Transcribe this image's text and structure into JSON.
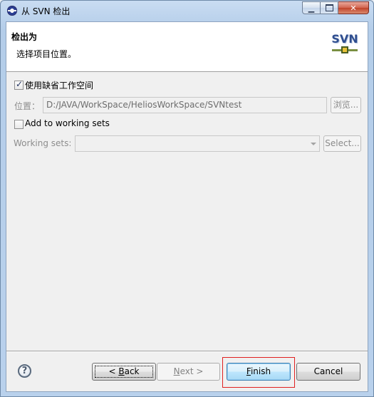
{
  "window": {
    "title": "从 SVN 检出",
    "controls": {
      "minimize": "minimize",
      "maximize": "maximize",
      "close": "close"
    }
  },
  "banner": {
    "title": "检出为",
    "description": "选择项目位置。",
    "logo_text": "SVN"
  },
  "options": {
    "use_default_workspace": {
      "label": "使用缺省工作空间",
      "checked": true
    },
    "location": {
      "label": "位置：",
      "value": "D:/JAVA/WorkSpace/HeliosWorkSpace/SVNtest",
      "browse_label": "浏览..."
    },
    "add_to_working_sets": {
      "label": "Add to working sets",
      "checked": false
    },
    "working_sets": {
      "label": "Working sets:",
      "value": "",
      "select_label": "Select..."
    }
  },
  "footer": {
    "help_symbol": "?",
    "back_prefix": "< ",
    "back_mnemonic": "B",
    "back_rest": "ack",
    "next_mnemonic": "N",
    "next_rest": "ext >",
    "finish_mnemonic": "F",
    "finish_rest": "inish",
    "cancel_label": "Cancel"
  },
  "colors": {
    "highlight_box": "#e02020",
    "banner_bg": "#ffffff",
    "dialog_bg": "#f0f0f0"
  }
}
